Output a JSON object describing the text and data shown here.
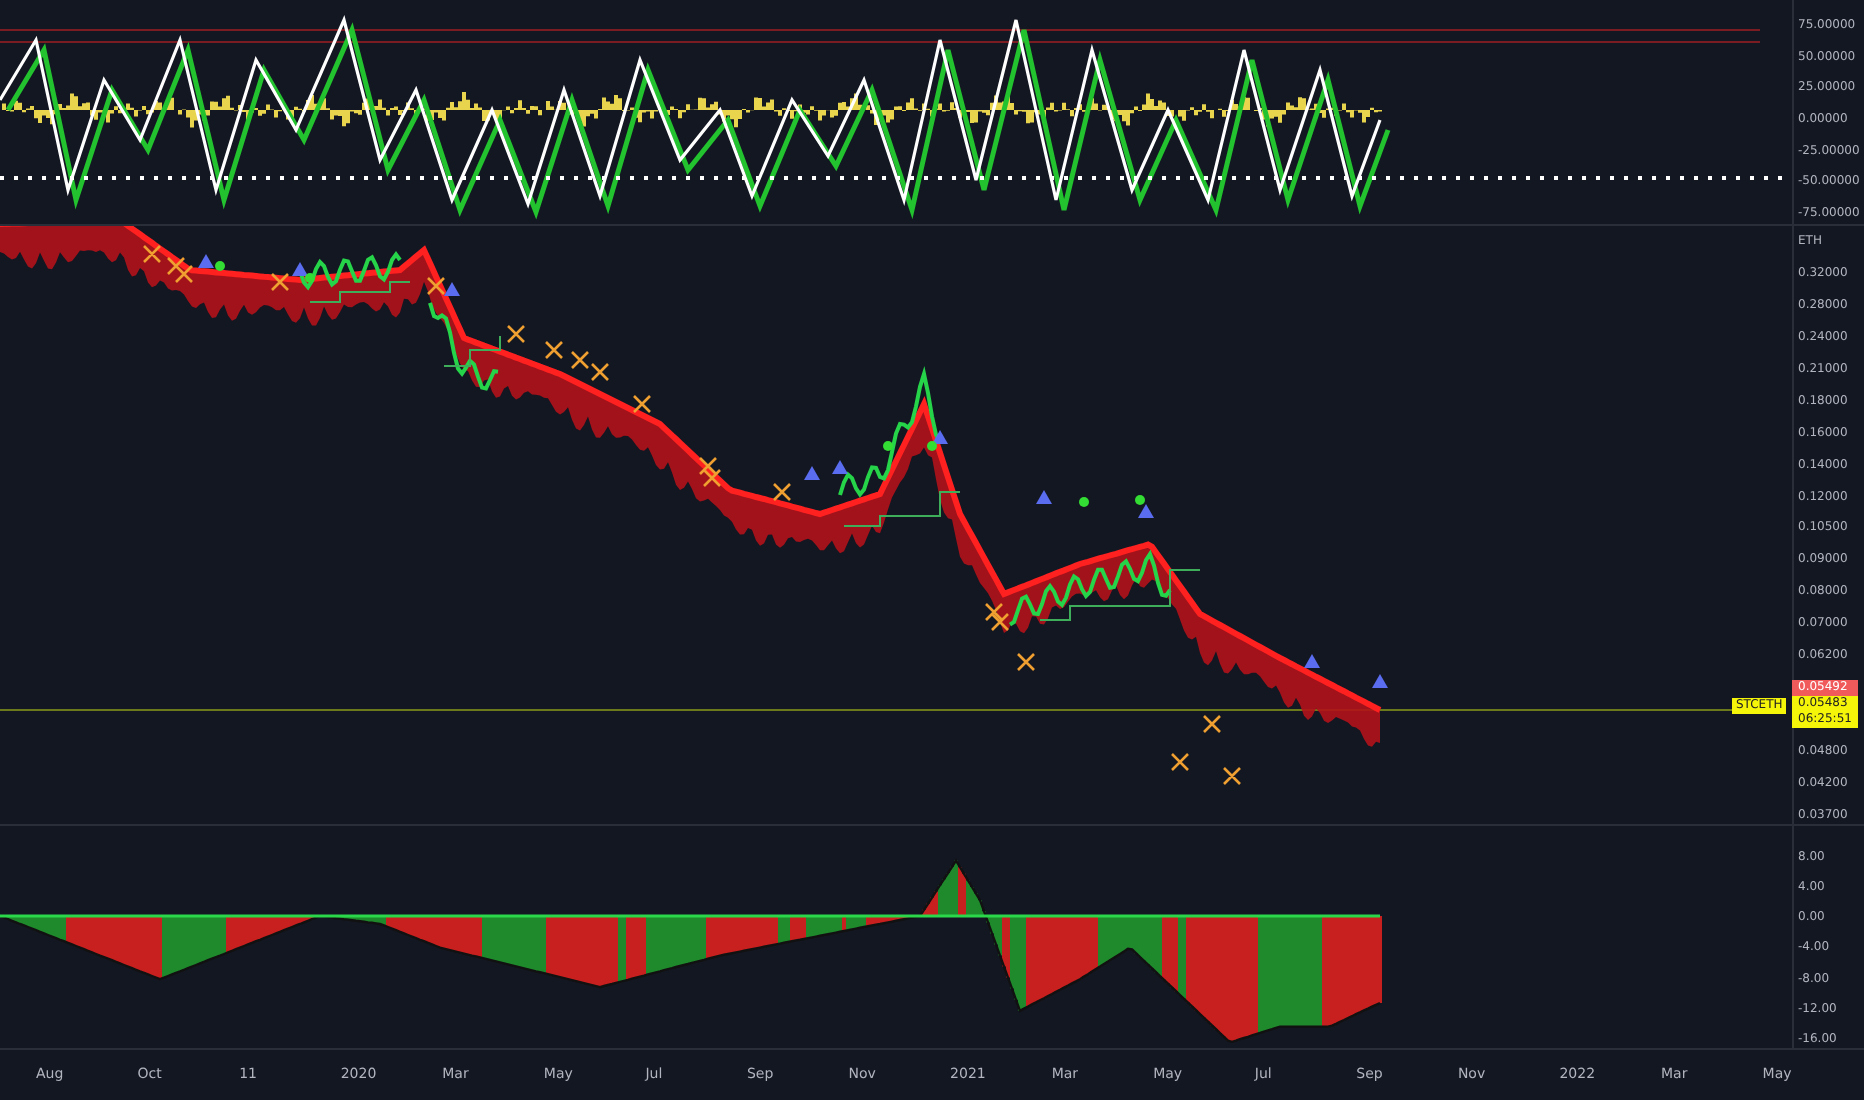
{
  "oscillator_panel": {
    "axis_labels": [
      "75.00000",
      "50.00000",
      "25.00000",
      "0.00000",
      "-25.00000",
      "-50.00000",
      "-75.00000"
    ]
  },
  "price_panel": {
    "currency": "ETH",
    "axis_labels": [
      "0.32000",
      "0.28000",
      "0.24000",
      "0.21000",
      "0.18000",
      "0.16000",
      "0.14000",
      "0.12000",
      "0.10500",
      "0.09000",
      "0.08000",
      "0.07000",
      "0.06200",
      "0.04800",
      "0.04200",
      "0.03700"
    ],
    "high_tag": "0.05492",
    "last_tag": {
      "symbol": "STCETH",
      "price": "0.05483",
      "countdown": "06:25:51"
    }
  },
  "histogram_panel": {
    "axis_labels": [
      "8.00",
      "4.00",
      "0.00",
      "-4.00",
      "-8.00",
      "-12.00",
      "-16.00"
    ]
  },
  "time_axis": [
    "Aug",
    "Oct",
    "11",
    "2020",
    "Mar",
    "May",
    "Jul",
    "Sep",
    "Nov",
    "2021",
    "Mar",
    "May",
    "Jul",
    "Sep",
    "Nov",
    "2022",
    "Mar",
    "May"
  ]
}
